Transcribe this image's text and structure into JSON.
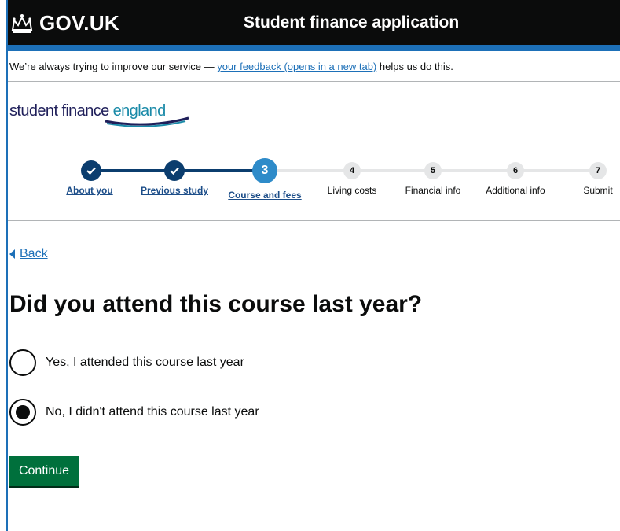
{
  "header": {
    "logo_text": "GOV.UK",
    "service_name": "Student finance application"
  },
  "phase_banner": {
    "text_before": "We’re always trying to improve our service — ",
    "link_text": "your feedback (opens in a new tab)",
    "text_after": " helps us do this."
  },
  "brand": {
    "part1": "student finance ",
    "part2": "england"
  },
  "stepper": {
    "steps": [
      {
        "number": "",
        "label": "About you",
        "state": "done"
      },
      {
        "number": "",
        "label": "Previous study",
        "state": "done"
      },
      {
        "number": "3",
        "label": "Course and fees",
        "state": "current"
      },
      {
        "number": "4",
        "label": "Living costs",
        "state": "todo"
      },
      {
        "number": "5",
        "label": "Financial info",
        "state": "todo"
      },
      {
        "number": "6",
        "label": "Additional info",
        "state": "todo"
      },
      {
        "number": "7",
        "label": "Submit",
        "state": "todo"
      }
    ]
  },
  "back_link": "Back",
  "question": {
    "title": "Did you attend this course last year?",
    "options": [
      {
        "label": "Yes, I attended this course last year",
        "selected": false
      },
      {
        "label": "No, I didn't attend this course last year",
        "selected": true
      }
    ]
  },
  "continue_label": "Continue",
  "colors": {
    "header_bg": "#0b0c0c",
    "accent_blue": "#1d70b8",
    "step_done": "#0b3d6e",
    "step_current": "#2e8bc9",
    "button_green": "#00703c"
  }
}
